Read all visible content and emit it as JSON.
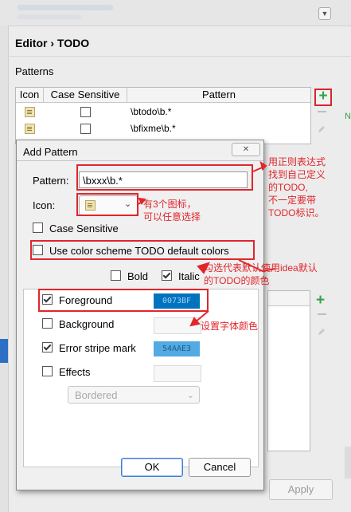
{
  "breadcrumb": {
    "parent": "Editor",
    "separator": "›",
    "current": "TODO"
  },
  "patterns_label": "Patterns",
  "table": {
    "headers": [
      "Icon",
      "Case Sensitive",
      "Pattern"
    ],
    "rows": [
      {
        "pattern": "\\btodo\\b.*"
      },
      {
        "pattern": "\\bfixme\\b.*"
      }
    ]
  },
  "apply_label": "Apply",
  "dialog": {
    "title": "Add Pattern",
    "pattern_label": "Pattern:",
    "pattern_value": "\\bxxx\\b.*",
    "icon_label": "Icon:",
    "case_sensitive_label": "Case Sensitive",
    "use_scheme_label": "Use color scheme TODO default colors",
    "bold_label": "Bold",
    "italic_label": "Italic",
    "foreground_label": "Foreground",
    "foreground_color": "0073BF",
    "background_label": "Background",
    "error_stripe_label": "Error stripe mark",
    "error_stripe_color": "54AAE3",
    "effects_label": "Effects",
    "effects_style": "Bordered",
    "ok_label": "OK",
    "cancel_label": "Cancel"
  },
  "annotations": {
    "pattern_note": "用正则表达式\n找到自己定义\n的TODO,\n不一定要带\nTODO标识。",
    "icon_note": "有3个图标，\n可以任意选择",
    "scheme_note": "勾选代表默认使用idea默认\n的TODO的颜色",
    "foreground_note": "设置字体颜色"
  },
  "colors": {
    "annotation_red": "#e0262c",
    "foreground_swatch": "#0073BF",
    "error_stripe_swatch": "#54AAE3",
    "add_green": "#36a24a"
  }
}
